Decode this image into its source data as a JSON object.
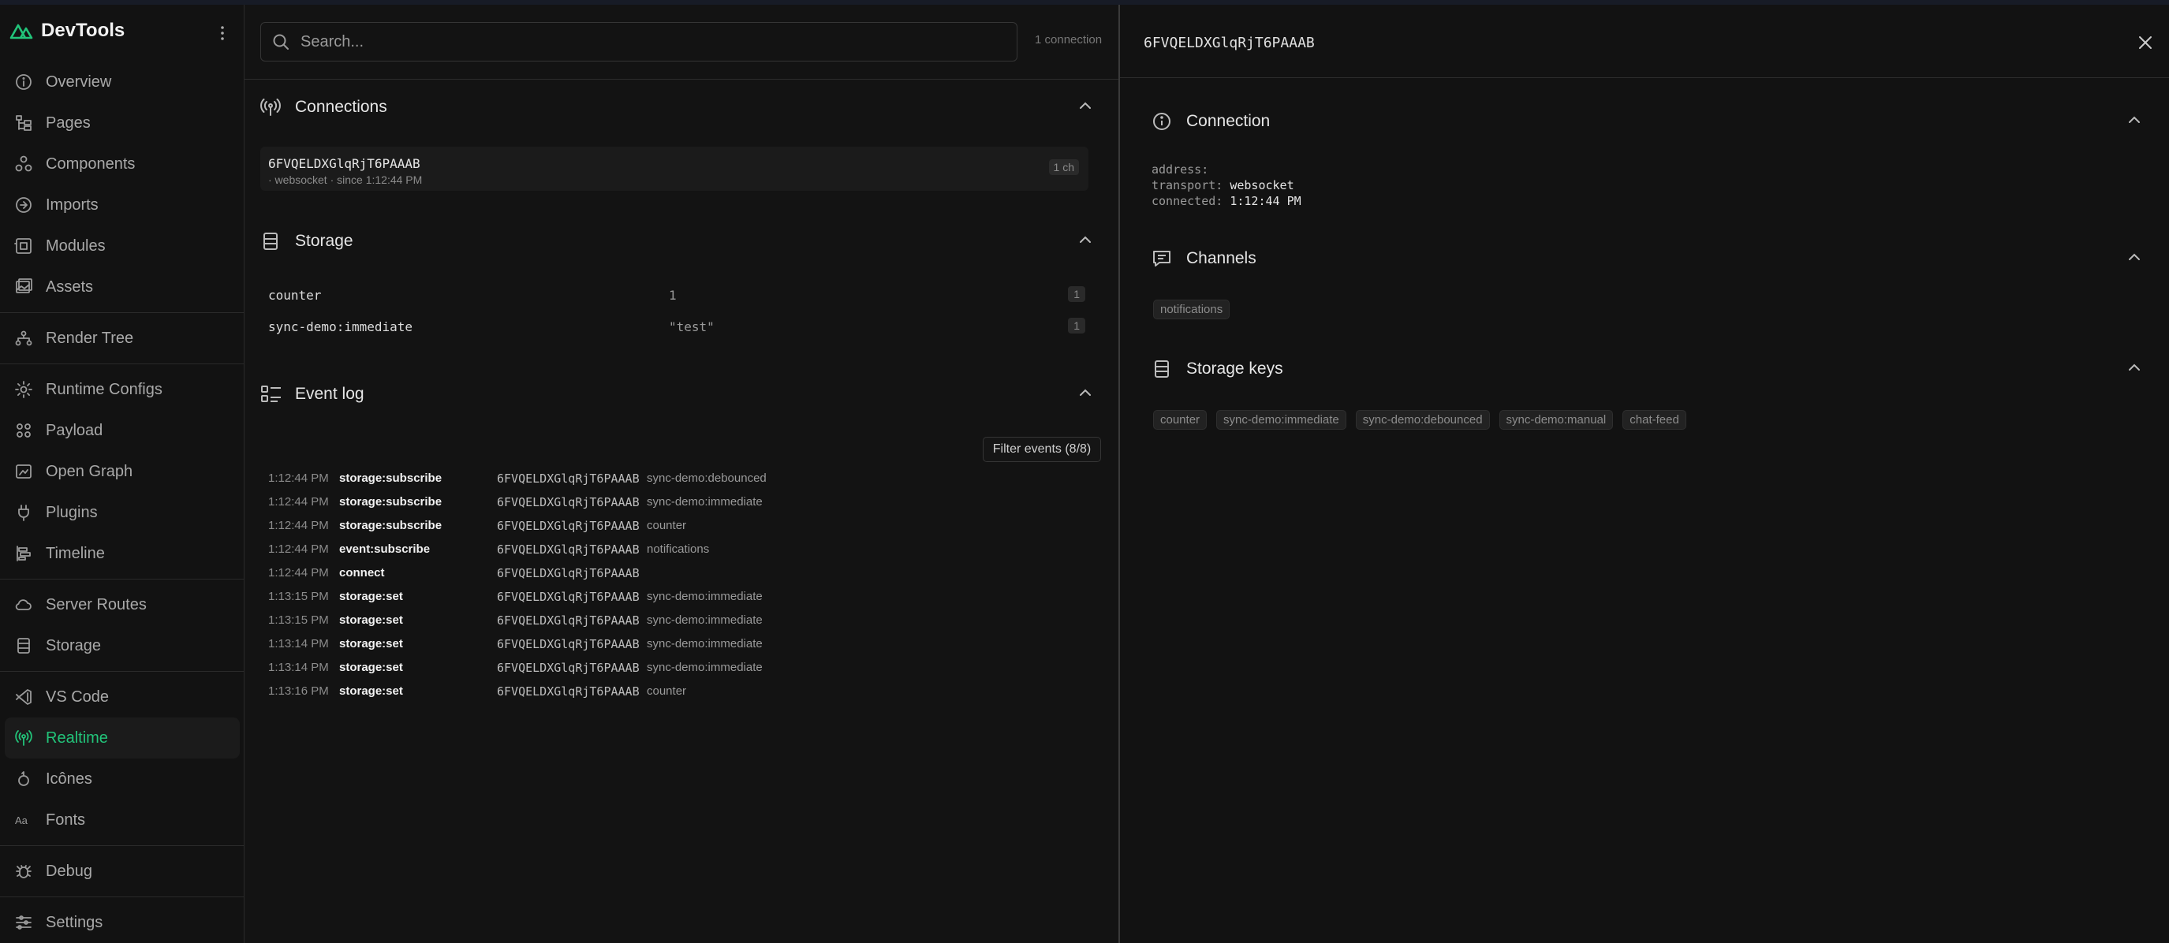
{
  "brand": {
    "name": "DevTools"
  },
  "sidebar": {
    "groups": [
      [
        {
          "label": "Overview",
          "icon": "info-icon"
        },
        {
          "label": "Pages",
          "icon": "pages-icon"
        },
        {
          "label": "Components",
          "icon": "components-icon"
        },
        {
          "label": "Imports",
          "icon": "imports-icon"
        },
        {
          "label": "Modules",
          "icon": "modules-icon"
        },
        {
          "label": "Assets",
          "icon": "assets-icon"
        }
      ],
      [
        {
          "label": "Render Tree",
          "icon": "render-tree-icon"
        }
      ],
      [
        {
          "label": "Runtime Configs",
          "icon": "gear-icon"
        },
        {
          "label": "Payload",
          "icon": "payload-icon"
        },
        {
          "label": "Open Graph",
          "icon": "open-graph-icon"
        },
        {
          "label": "Plugins",
          "icon": "plug-icon"
        },
        {
          "label": "Timeline",
          "icon": "timeline-icon"
        }
      ],
      [
        {
          "label": "Server Routes",
          "icon": "cloud-icon"
        },
        {
          "label": "Storage",
          "icon": "storage-icon"
        }
      ],
      [
        {
          "label": "VS Code",
          "icon": "vscode-icon"
        },
        {
          "label": "Realtime",
          "icon": "antenna-icon",
          "active": true
        },
        {
          "label": "Icônes",
          "icon": "icones-icon"
        },
        {
          "label": "Fonts",
          "icon": "fonts-icon"
        }
      ],
      [
        {
          "label": "Debug",
          "icon": "bug-icon"
        }
      ],
      [
        {
          "label": "Settings",
          "icon": "settings-icon"
        }
      ]
    ]
  },
  "search": {
    "placeholder": "Search...",
    "value": ""
  },
  "connection_count": "1 connection",
  "connections": {
    "title": "Connections",
    "items": [
      {
        "id": "6FVQELDXGlqRjT6PAAAB",
        "sub": "· websocket · since 1:12:44 PM",
        "badge": "1 ch"
      }
    ]
  },
  "storage": {
    "title": "Storage",
    "rows": [
      {
        "key": "counter",
        "value": "1",
        "count": "1"
      },
      {
        "key": "sync-demo:immediate",
        "value": "\"test\"",
        "count": "1"
      }
    ]
  },
  "event_log": {
    "title": "Event log",
    "filter_label": "Filter events (8/8)",
    "events": [
      {
        "time": "1:12:44 PM",
        "type": "storage:subscribe",
        "id": "6FVQELDXGlqRjT6PAAAB",
        "channel": "sync-demo:debounced"
      },
      {
        "time": "1:12:44 PM",
        "type": "storage:subscribe",
        "id": "6FVQELDXGlqRjT6PAAAB",
        "channel": "sync-demo:immediate"
      },
      {
        "time": "1:12:44 PM",
        "type": "storage:subscribe",
        "id": "6FVQELDXGlqRjT6PAAAB",
        "channel": "counter"
      },
      {
        "time": "1:12:44 PM",
        "type": "event:subscribe",
        "id": "6FVQELDXGlqRjT6PAAAB",
        "channel": "notifications"
      },
      {
        "time": "1:12:44 PM",
        "type": "connect",
        "id": "6FVQELDXGlqRjT6PAAAB",
        "channel": ""
      },
      {
        "time": "1:13:15 PM",
        "type": "storage:set",
        "id": "6FVQELDXGlqRjT6PAAAB",
        "channel": "sync-demo:immediate"
      },
      {
        "time": "1:13:15 PM",
        "type": "storage:set",
        "id": "6FVQELDXGlqRjT6PAAAB",
        "channel": "sync-demo:immediate"
      },
      {
        "time": "1:13:14 PM",
        "type": "storage:set",
        "id": "6FVQELDXGlqRjT6PAAAB",
        "channel": "sync-demo:immediate"
      },
      {
        "time": "1:13:14 PM",
        "type": "storage:set",
        "id": "6FVQELDXGlqRjT6PAAAB",
        "channel": "sync-demo:immediate"
      },
      {
        "time": "1:13:16 PM",
        "type": "storage:set",
        "id": "6FVQELDXGlqRjT6PAAAB",
        "channel": "counter"
      }
    ]
  },
  "detail": {
    "title": "6FVQELDXGlqRjT6PAAAB",
    "connection": {
      "title": "Connection",
      "address_label": "address:",
      "address_value": "",
      "transport_label": "transport:",
      "transport_value": "websocket",
      "connected_label": "connected:",
      "connected_value": "1:12:44 PM"
    },
    "channels": {
      "title": "Channels",
      "tags": [
        "notifications"
      ]
    },
    "storage_keys": {
      "title": "Storage keys",
      "tags": [
        "counter",
        "sync-demo:immediate",
        "sync-demo:debounced",
        "sync-demo:manual",
        "chat-feed"
      ]
    }
  },
  "colors": {
    "accent": "#22c47a",
    "background": "#121212"
  }
}
